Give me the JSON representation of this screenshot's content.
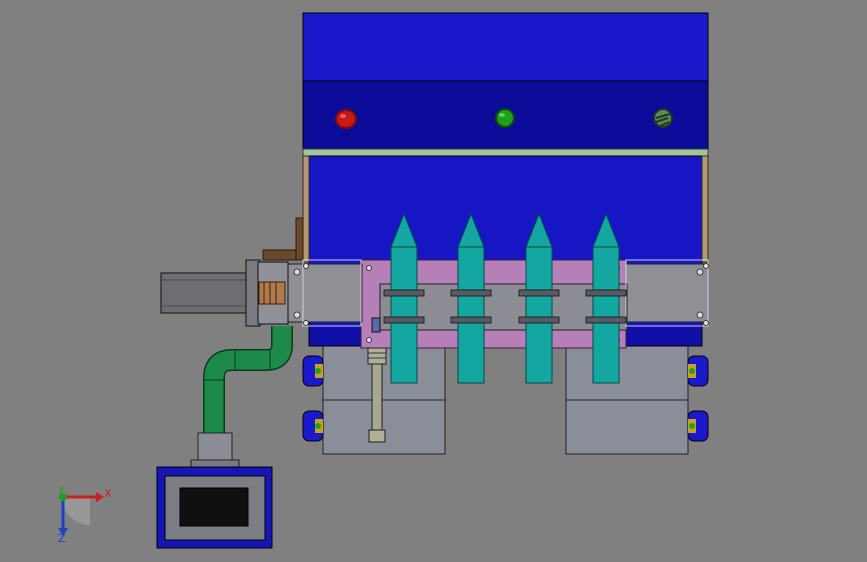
{
  "view": {
    "background": "#808080",
    "model": "cad-assembly-front-view"
  },
  "colors": {
    "cabinet_top": "#1a1acc",
    "cabinet_panel": "#0c0c9a",
    "cabinet_lower": "#1616c4",
    "frame_rail": "#a4c4a0",
    "frame_post": "#b49a74",
    "plate_grey": "#8f8f96",
    "plate_pink": "#b67fb8",
    "nozzle_teal": "#14a6a0",
    "motor_grey": "#6d6d72",
    "coupling_copper": "#b07a4a",
    "pipe_green": "#1e8a4a",
    "block_grey": "#8a8e98",
    "port_blue": "#1a1acc",
    "hopper_blue": "#1616b8",
    "axis_x": "#cc2020",
    "axis_y": "#20a020",
    "axis_z": "#2040c8"
  },
  "icons": {
    "indicator_red": "indicator-light-red",
    "indicator_green": "indicator-light-green",
    "indicator_knob": "selector-knob"
  },
  "triad": {
    "x_label": "X",
    "y_label": "Y",
    "z_label": "Z"
  }
}
